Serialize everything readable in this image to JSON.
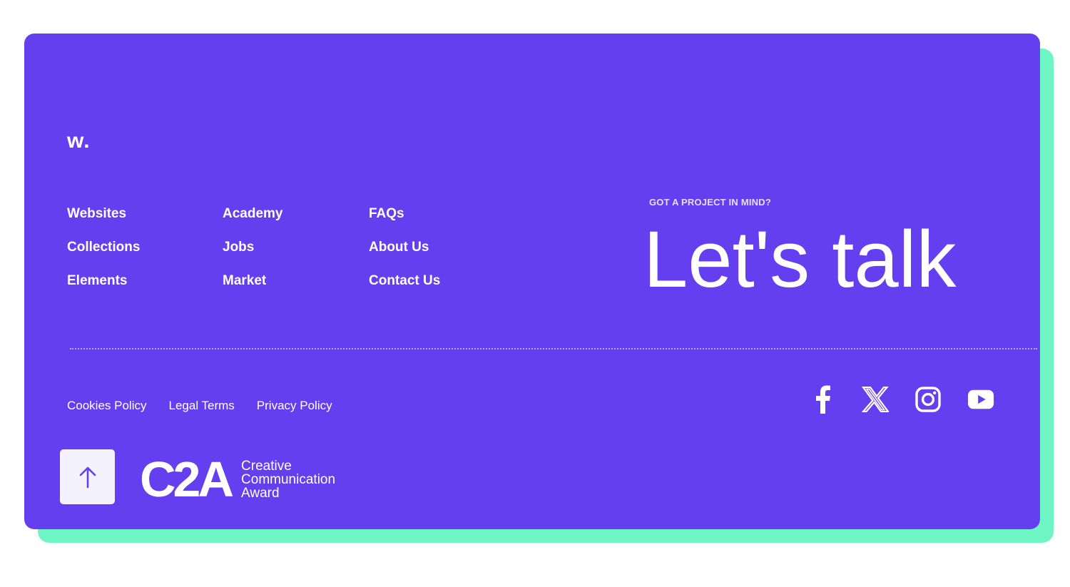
{
  "logo": {
    "text": "w."
  },
  "nav": {
    "columns": [
      [
        "Websites",
        "Collections",
        "Elements"
      ],
      [
        "Academy",
        "Jobs",
        "Market"
      ],
      [
        "FAQs",
        "About Us",
        "Contact Us"
      ]
    ]
  },
  "cta": {
    "kicker": "GOT A PROJECT IN MIND?",
    "headline": "Let's talk"
  },
  "legal": {
    "links": [
      "Cookies Policy",
      "Legal Terms",
      "Privacy Policy"
    ]
  },
  "social": {
    "icons": [
      "facebook-icon",
      "x-icon",
      "instagram-icon",
      "youtube-icon"
    ]
  },
  "scroll_top": {
    "icon": "arrow-up-icon"
  },
  "award": {
    "mark": "C2A",
    "lines": [
      "Creative",
      "Communication",
      "Award"
    ]
  },
  "colors": {
    "brand": "#633ff0",
    "accent_shadow": "#6ef5c4",
    "text": "#ffffff",
    "button_bg": "#f5f2ff"
  }
}
